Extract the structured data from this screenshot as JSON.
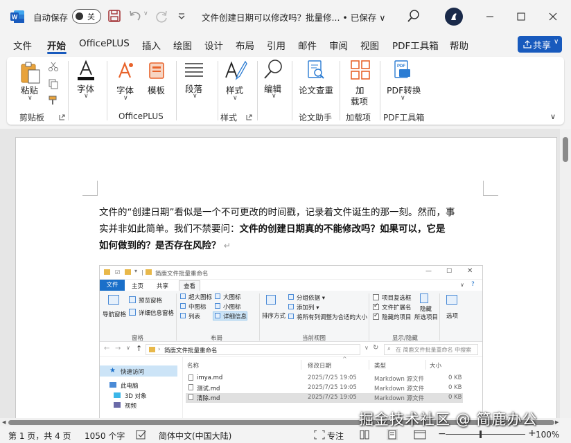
{
  "titlebar": {
    "autosave_label": "自动保存",
    "autosave_state": "关",
    "doc_title": "文件创建日期可以修改吗？批量修... • 已保存 ∨"
  },
  "tabs": [
    "文件",
    "开始",
    "OfficePLUS",
    "插入",
    "绘图",
    "设计",
    "布局",
    "引用",
    "邮件",
    "审阅",
    "视图",
    "PDF工具箱",
    "帮助"
  ],
  "active_tab": "开始",
  "share_label": "共享",
  "ribbon": {
    "paste": "粘贴",
    "font_main": "字体",
    "font_plus": "字体",
    "template": "模板",
    "paragraph": "段落",
    "styles": "样式",
    "editing": "编辑",
    "paper_check": "论文查重",
    "addins_line1": "加",
    "addins_line2": "载项",
    "pdf_convert": "PDF转换",
    "groups": {
      "clipboard": "剪贴板",
      "officeplus": "OfficePLUS",
      "style": "样式",
      "paper": "论文助手",
      "addins": "加载项",
      "pdf": "PDF工具箱"
    }
  },
  "document": {
    "line1": "文件的“创建日期”看似是一个不可更改的时间戳，记录着文件诞生的那一刻。然而，事",
    "line2_normal": "实并非如此简单。我们不禁要问：",
    "line2_bold": "文件的创建日期真的不能修改吗？如果可以，它是",
    "line3_bold": "如何做到的？是否存在风险？",
    "para_mark": "↵"
  },
  "explorer": {
    "title": "简鹿文件批量重命名",
    "tabs": {
      "file": "文件",
      "home": "主页",
      "share": "共享",
      "view": "查看"
    },
    "ribbon": {
      "nav_pane": "导航窗格",
      "preview_pane": "预览窗格",
      "details_pane": "详细信息窗格",
      "xl_icons": "超大图标",
      "l_icons": "大图标",
      "m_icons": "中图标",
      "s_icons": "小图标",
      "list": "列表",
      "details": "详细信息",
      "sort": "排序方式",
      "group_by": "分组依据 ▾",
      "add_col": "添加列 ▾",
      "fit_cols": "将所有列调整为合适的大小",
      "item_check": "项目复选框",
      "ext": "文件扩展名",
      "hidden_items": "隐藏的项目",
      "hide": "隐藏",
      "selected": "所选项目",
      "options": "选项",
      "grp_pane": "窗格",
      "grp_layout": "布局",
      "grp_view": "当前视图",
      "grp_showhide": "显示/隐藏"
    },
    "address": "简鹿文件批量重命名",
    "search_placeholder": "在 简鹿文件批量重命名 中搜索",
    "nav": {
      "quick": "快速访问",
      "pc": "此电脑",
      "objects": "3D 对象",
      "video": "视频"
    },
    "columns": {
      "name": "名称",
      "date": "修改日期",
      "type": "类型",
      "size": "大小"
    },
    "files": [
      {
        "name": "imya.md",
        "date": "2025/7/25 19:05",
        "type": "Markdown 源文件",
        "size": "0 KB"
      },
      {
        "name": "测试.md",
        "date": "2025/7/25 19:05",
        "type": "Markdown 源文件",
        "size": "0 KB"
      },
      {
        "name": "清除.md",
        "date": "2025/7/25 19:05",
        "type": "Markdown 源文件",
        "size": "0 KB"
      }
    ]
  },
  "status": {
    "page": "第 1 页，共 4 页",
    "words": "1050 个字",
    "lang": "简体中文(中国大陆)",
    "focus": "专注",
    "zoom": "100%"
  },
  "watermark": "掘金技术社区 @ 简鹿办公",
  "colors": {
    "accent": "#185abd",
    "word_blue": "#185abd",
    "explorer_blue": "#1a6fc9"
  }
}
